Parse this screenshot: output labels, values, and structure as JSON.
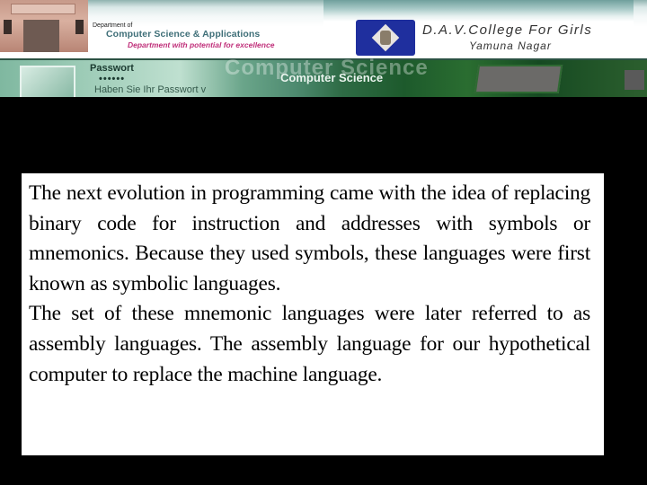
{
  "header": {
    "department_prefix": "Department of",
    "department_name": "Computer Science & Applications",
    "department_tagline": "Department with potential for excellence",
    "college_name": "D.A.V.College For Girls",
    "college_city": "Yamuna Nagar",
    "banner_password_label": "Passwort",
    "banner_password_dots": "••••••",
    "banner_password_hint": "Haben Sie Ihr Passwort v",
    "banner_ghost_text": "Computer Science",
    "banner_text": "Computer Science",
    "logo_icon": "college-emblem-icon"
  },
  "content": {
    "paragraphs": [
      "The next evolution in programming came with the idea of replacing binary code for instruction and addresses with symbols or mnemonics. Because they used symbols, these languages were first known as symbolic languages.",
      "The set of these mnemonic languages were later referred to as assembly languages. The assembly language for our hypothetical computer to replace the machine language."
    ]
  },
  "colors": {
    "background": "#000000",
    "content_box": "#ffffff",
    "text": "#000000",
    "department_accent": "#3f6f78",
    "tagline_accent": "#c0307a",
    "logo_blue": "#1f2f9e"
  }
}
